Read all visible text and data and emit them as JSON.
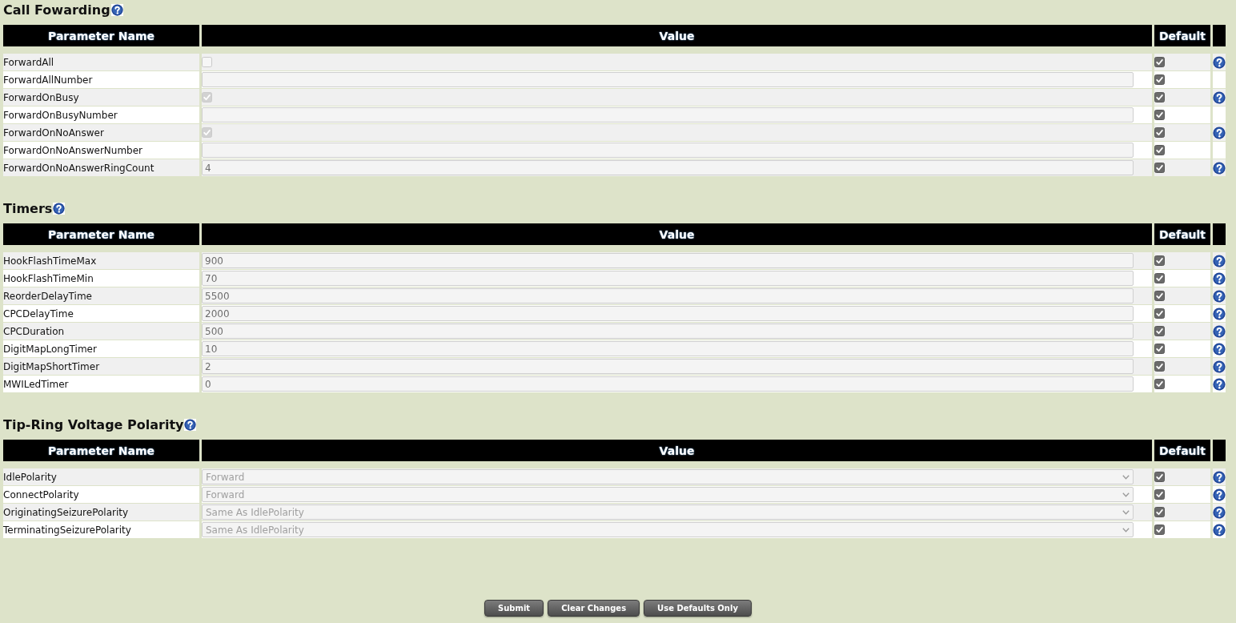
{
  "sections": [
    {
      "title": "Call Fowarding",
      "help": true,
      "columns": [
        "Parameter Name",
        "Value",
        "Default"
      ],
      "rows": [
        {
          "name": "ForwardAll",
          "kind": "checkbox",
          "checked": false,
          "disabled": true,
          "default_checked": true,
          "help": true
        },
        {
          "name": "ForwardAllNumber",
          "kind": "text",
          "disabled": true,
          "default_checked": true,
          "help": false
        },
        {
          "name": "ForwardOnBusy",
          "kind": "checkbox",
          "checked": true,
          "disabled": true,
          "default_checked": true,
          "help": true
        },
        {
          "name": "ForwardOnBusyNumber",
          "kind": "text",
          "disabled": true,
          "default_checked": true,
          "help": false
        },
        {
          "name": "ForwardOnNoAnswer",
          "kind": "checkbox",
          "checked": true,
          "disabled": true,
          "default_checked": true,
          "help": true
        },
        {
          "name": "ForwardOnNoAnswerNumber",
          "kind": "text",
          "disabled": true,
          "default_checked": true,
          "help": false
        },
        {
          "name": "ForwardOnNoAnswerRingCount",
          "kind": "text",
          "value": "4",
          "disabled": true,
          "default_checked": true,
          "help": true
        }
      ]
    },
    {
      "title": "Timers",
      "help": true,
      "columns": [
        "Parameter Name",
        "Value",
        "Default"
      ],
      "rows": [
        {
          "name": "HookFlashTimeMax",
          "kind": "text",
          "value": "900",
          "disabled": true,
          "default_checked": true,
          "help": true
        },
        {
          "name": "HookFlashTimeMin",
          "kind": "text",
          "value": "70",
          "disabled": true,
          "default_checked": true,
          "help": true
        },
        {
          "name": "ReorderDelayTime",
          "kind": "text",
          "value": "5500",
          "disabled": true,
          "default_checked": true,
          "help": true
        },
        {
          "name": "CPCDelayTime",
          "kind": "text",
          "value": "2000",
          "disabled": true,
          "default_checked": true,
          "help": true
        },
        {
          "name": "CPCDuration",
          "kind": "text",
          "value": "500",
          "disabled": true,
          "default_checked": true,
          "help": true
        },
        {
          "name": "DigitMapLongTimer",
          "kind": "text",
          "value": "10",
          "disabled": true,
          "default_checked": true,
          "help": true
        },
        {
          "name": "DigitMapShortTimer",
          "kind": "text",
          "value": "2",
          "disabled": true,
          "default_checked": true,
          "help": true
        },
        {
          "name": "MWILedTimer",
          "kind": "text",
          "value": "0",
          "disabled": true,
          "default_checked": true,
          "help": true
        }
      ]
    },
    {
      "title": "Tip-Ring Voltage Polarity",
      "help": true,
      "columns": [
        "Parameter Name",
        "Value",
        "Default"
      ],
      "rows": [
        {
          "name": "IdlePolarity",
          "kind": "select",
          "value": "Forward",
          "disabled": true,
          "default_checked": true,
          "help": true
        },
        {
          "name": "ConnectPolarity",
          "kind": "select",
          "value": "Forward",
          "disabled": true,
          "default_checked": true,
          "help": true
        },
        {
          "name": "OriginatingSeizurePolarity",
          "kind": "select",
          "value": "Same As IdlePolarity",
          "disabled": true,
          "default_checked": true,
          "help": true
        },
        {
          "name": "TerminatingSeizurePolarity",
          "kind": "select",
          "value": "Same As IdlePolarity",
          "disabled": true,
          "default_checked": true,
          "help": true
        }
      ]
    }
  ],
  "buttons": [
    "Submit",
    "Clear Changes",
    "Use Defaults Only"
  ]
}
